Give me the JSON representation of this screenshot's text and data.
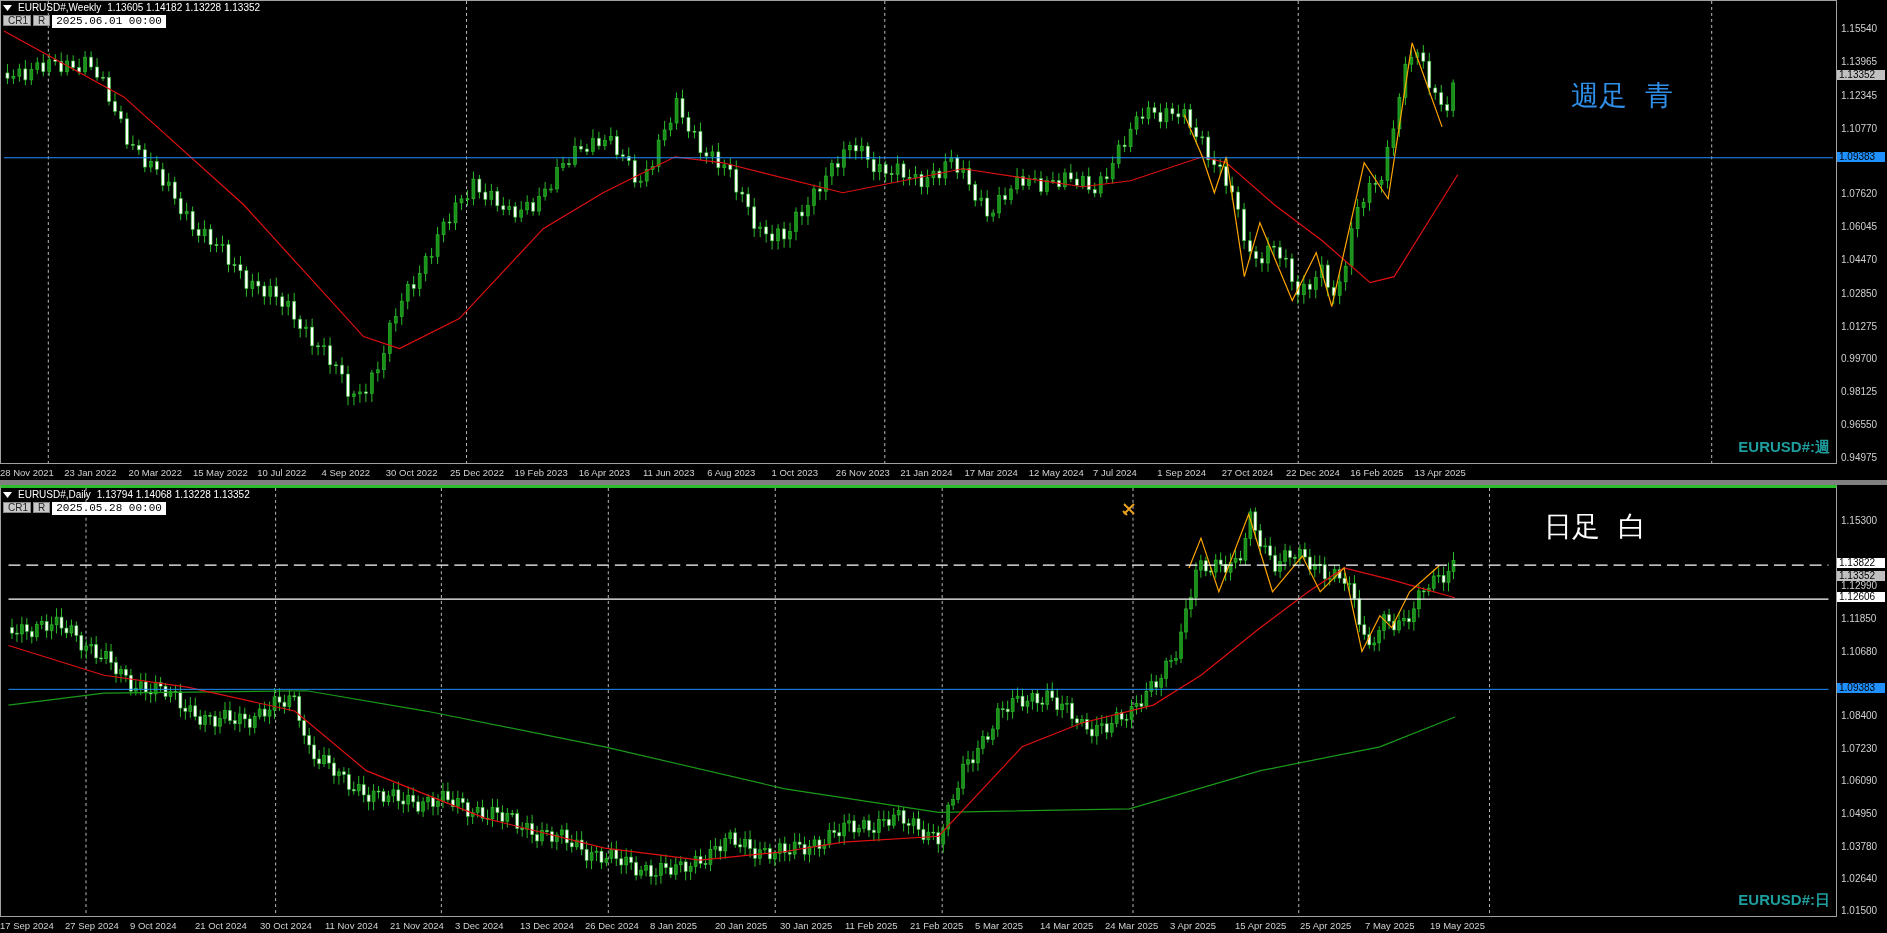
{
  "panels": [
    {
      "title": "EURUSD#,Weekly",
      "ohlc": "1.13605 1.14182 1.13228 1.13352",
      "buttons": [
        "CR1",
        "R"
      ],
      "date_field": "2025.06.01 00:00",
      "note": {
        "text": "週足  青",
        "color": "#2f8fe8"
      },
      "symbol_label": "EURUSD#:週",
      "price_labels": [
        "1.15540",
        "1.13965",
        "1.12345",
        "1.10770",
        "1.07620",
        "1.06045",
        "1.04470",
        "1.02850",
        "1.01275",
        "0.99700",
        "0.98125",
        "0.96550",
        "0.94975"
      ],
      "price_markers": [
        {
          "value": "1.13352",
          "kind": "bid"
        },
        {
          "value": "1.09383",
          "kind": "blue"
        }
      ],
      "time_labels": [
        "28 Nov 2021",
        "23 Jan 2022",
        "20 Mar 2022",
        "15 May 2022",
        "10 Jul 2022",
        "4 Sep 2022",
        "30 Oct 2022",
        "25 Dec 2022",
        "19 Feb 2023",
        "16 Apr 2023",
        "11 Jun 2023",
        "6 Aug 2023",
        "1 Oct 2023",
        "26 Nov 2023",
        "21 Jan 2024",
        "17 Mar 2024",
        "12 May 2024",
        "7 Jul 2024",
        "1 Sep 2024",
        "27 Oct 2024",
        "22 Dec 2024",
        "16 Feb 2025",
        "13 Apr 2025"
      ]
    },
    {
      "title": "EURUSD#,Daily",
      "ohlc": "1.13794 1.14068 1.13228 1.13352",
      "buttons": [
        "CR1",
        "R"
      ],
      "date_field": "2025.05.28 00:00",
      "note": {
        "text": "日足  白",
        "color": "#ffffff"
      },
      "symbol_label": "EURUSD#:日",
      "price_labels": [
        "1.15300",
        "1.12990",
        "1.11850",
        "1.10680",
        "1.08400",
        "1.07230",
        "1.06090",
        "1.04950",
        "1.03780",
        "1.02640",
        "1.01500"
      ],
      "price_markers": [
        {
          "value": "1.13822",
          "kind": "dashed"
        },
        {
          "value": "1.13352",
          "kind": "bid"
        },
        {
          "value": "1.12606",
          "kind": "solid"
        },
        {
          "value": "1.09383",
          "kind": "blue"
        }
      ],
      "time_labels": [
        "17 Sep 2024",
        "27 Sep 2024",
        "9 Oct 2024",
        "21 Oct 2024",
        "30 Oct 2024",
        "11 Nov 2024",
        "21 Nov 2024",
        "3 Dec 2024",
        "13 Dec 2024",
        "26 Dec 2024",
        "8 Jan 2025",
        "20 Jan 2025",
        "30 Jan 2025",
        "11 Feb 2025",
        "21 Feb 2025",
        "5 Mar 2025",
        "14 Mar 2025",
        "24 Mar 2025",
        "3 Apr 2025",
        "15 Apr 2025",
        "25 Apr 2025",
        "7 May 2025",
        "19 May 2025"
      ]
    }
  ]
}
